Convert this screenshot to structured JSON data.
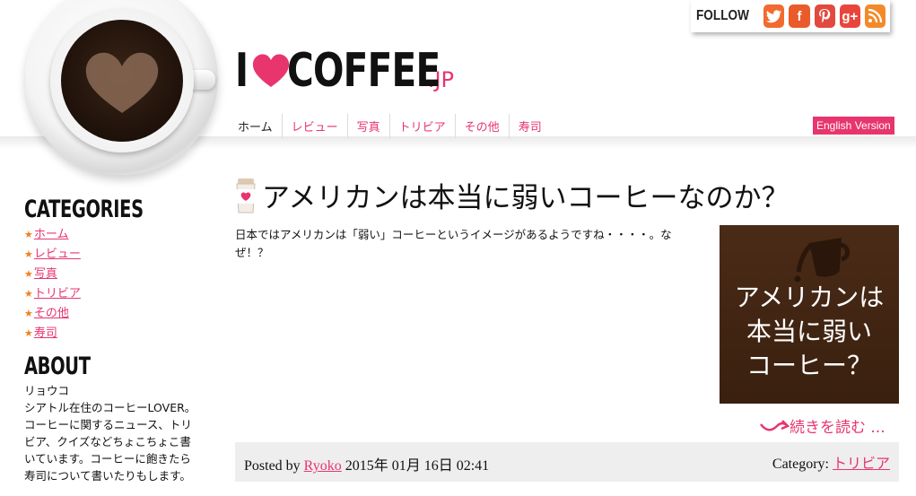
{
  "header": {
    "logo_i": "I",
    "logo_coffee": "COFFEE",
    "logo_jp": ".JP",
    "nav": [
      "ホーム",
      "レビュー",
      "写真",
      "トリビア",
      "その他",
      "寿司"
    ],
    "english_version": "English Version",
    "follow_label": "FOLLOW",
    "social_icons": [
      "twitter-icon",
      "facebook-icon",
      "pinterest-icon",
      "google-plus-icon",
      "rss-icon"
    ]
  },
  "sidebar": {
    "categories_heading": "CATEGORIES",
    "categories": [
      "ホーム",
      "レビュー",
      "写真",
      "トリビア",
      "その他",
      "寿司"
    ],
    "about_heading": "ABOUT",
    "about_text": "リョウコ\nシアトル在住のコーヒーLOVER。\nコーヒーに関するニュース、トリ\nビア、クイズなどちょこちょこ書\nいています。コーヒーに飽きたら\n寿司について書いたりもします。"
  },
  "post": {
    "title": "アメリカンは本当に弱いコーヒーなのか？",
    "excerpt": "日本ではアメリカンは「弱い」コーヒーというイメージがあるようですね・・・・。なぜ！？",
    "image_text": "アメリカンは\n本当に弱い\nコーヒー？",
    "read_more": "続きを読む ...",
    "posted_by_label": "Posted by",
    "author": "Ryoko",
    "date": "2015年 01月 16日 02:41",
    "category_label": "Category:",
    "category": "トリビア"
  },
  "colors": {
    "accent": "#e8356e",
    "coffee_brown": "#3a200f"
  }
}
